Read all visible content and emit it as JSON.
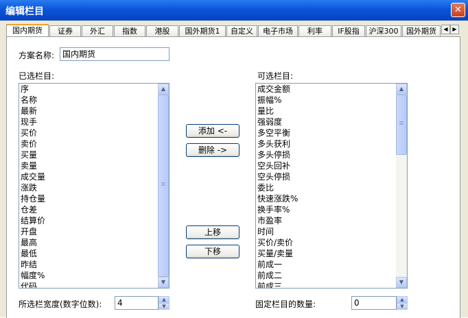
{
  "window": {
    "title": "编辑栏目",
    "close_glyph": "✕"
  },
  "tabs": [
    {
      "label": "国内期货"
    },
    {
      "label": "证券"
    },
    {
      "label": "外汇"
    },
    {
      "label": "指数"
    },
    {
      "label": "港股"
    },
    {
      "label": "国外期货1"
    },
    {
      "label": "自定义"
    },
    {
      "label": "电子市场"
    },
    {
      "label": "利率"
    },
    {
      "label": "IF股指"
    },
    {
      "label": "沪深300"
    },
    {
      "label": "国外期货"
    }
  ],
  "scheme": {
    "label": "方案名称:",
    "value": "国内期货"
  },
  "selected": {
    "label": "已选栏目:",
    "items": [
      "序",
      "名称",
      "最新",
      "现手",
      "买价",
      "卖价",
      "买量",
      "卖量",
      "成交量",
      "涨跌",
      "持仓量",
      "仓差",
      "结算价",
      "开盘",
      "最高",
      "最低",
      "昨结",
      "幅度%",
      "代码"
    ]
  },
  "available": {
    "label": "可选栏目:",
    "items": [
      "成交金额",
      "振幅%",
      "量比",
      "强弱度",
      "多空平衡",
      "多头获利",
      "多头停损",
      "空头回补",
      "空头停损",
      "委比",
      "快速涨跌%",
      "换手率%",
      "市盈率",
      "时间",
      "买价/卖价",
      "买量/卖量",
      "前成一",
      "前成二",
      "前成三"
    ]
  },
  "buttons": {
    "add": "添加 <-",
    "delete": "删除 ->",
    "up": "上移",
    "down": "下移"
  },
  "width_setting": {
    "label": "所选栏宽度(数字位数):",
    "value": "4"
  },
  "fixed_setting": {
    "label": "固定栏目的数量:",
    "value": "0"
  },
  "icons": {
    "up": "▲",
    "down": "▼",
    "left": "◀",
    "right": "▶"
  }
}
